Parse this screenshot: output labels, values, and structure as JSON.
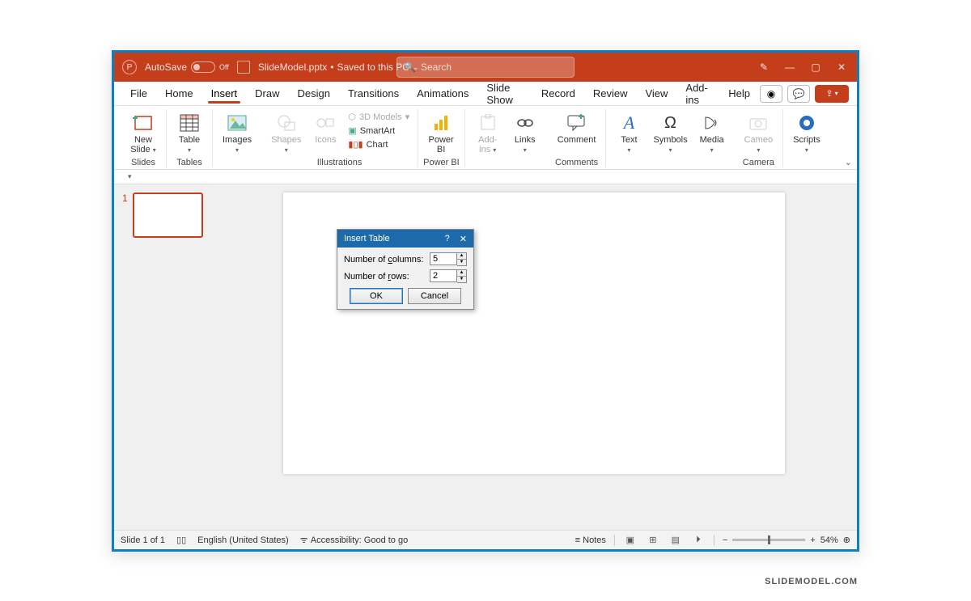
{
  "titlebar": {
    "autosave_label": "AutoSave",
    "autosave_state": "Off",
    "filename": "SlideModel.pptx",
    "saved_status": "Saved to this PC",
    "search_placeholder": "Search"
  },
  "menu": {
    "tabs": [
      "File",
      "Home",
      "Insert",
      "Draw",
      "Design",
      "Transitions",
      "Animations",
      "Slide Show",
      "Record",
      "Review",
      "View",
      "Add-ins",
      "Help"
    ],
    "active_index": 2
  },
  "ribbon": {
    "groups": {
      "slides": {
        "label": "Slides",
        "new_slide": "New\nSlide"
      },
      "tables": {
        "label": "Tables",
        "table": "Table"
      },
      "images": {
        "label": "",
        "images": "Images"
      },
      "illustrations": {
        "label": "Illustrations",
        "shapes": "Shapes",
        "icons": "Icons",
        "models3d": "3D Models",
        "smartart": "SmartArt",
        "chart": "Chart"
      },
      "powerbi": {
        "label": "Power BI",
        "powerbi": "Power\nBI"
      },
      "addins": {
        "label": "",
        "addins": "Add-\nins"
      },
      "links": {
        "label": "",
        "links": "Links"
      },
      "comments": {
        "label": "Comments",
        "comment": "Comment"
      },
      "text": {
        "label": "",
        "text": "Text"
      },
      "symbols": {
        "label": "",
        "symbols": "Symbols"
      },
      "media": {
        "label": "",
        "media": "Media"
      },
      "camera": {
        "label": "Camera",
        "cameo": "Cameo"
      },
      "scripts": {
        "label": "",
        "scripts": "Scripts"
      }
    }
  },
  "slide_panel": {
    "current_slide_number": "1"
  },
  "dialog": {
    "title": "Insert Table",
    "columns_label_pre": "Number of ",
    "columns_label_u": "c",
    "columns_label_post": "olumns:",
    "columns_value": "5",
    "rows_label_pre": "Number of ",
    "rows_label_u": "r",
    "rows_label_post": "ows:",
    "rows_value": "2",
    "ok": "OK",
    "cancel": "Cancel"
  },
  "statusbar": {
    "slide_info": "Slide 1 of 1",
    "language": "English (United States)",
    "accessibility": "Accessibility: Good to go",
    "notes": "Notes",
    "zoom": "54%"
  },
  "watermark": "SLIDEMODEL.COM"
}
